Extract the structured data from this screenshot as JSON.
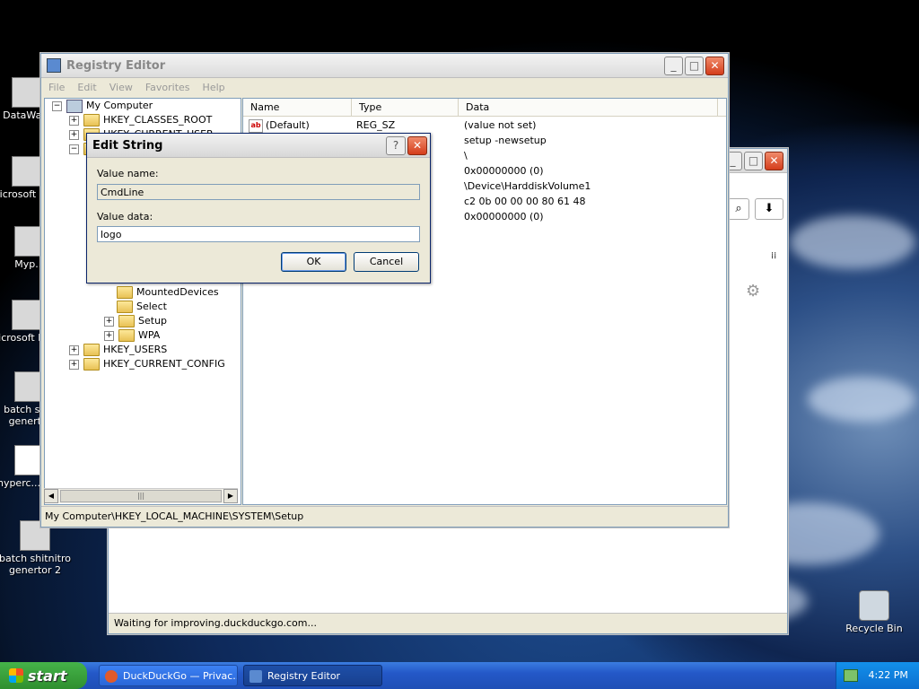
{
  "desktop": {
    "icons": [
      {
        "label": "DataWa..."
      },
      {
        "label": "Microsoft C++"
      },
      {
        "label": "Myp..."
      },
      {
        "label": "Microsoft Basic"
      },
      {
        "label": "batch sh... genert..."
      },
      {
        "label": "hyperc... age"
      },
      {
        "label": "batch shitnitro genertor 2"
      },
      {
        "label": "Recycle Bin"
      }
    ]
  },
  "browser": {
    "status": "Waiting for improving.duckduckgo.com..."
  },
  "regedit": {
    "title": "Registry Editor",
    "menu": [
      "File",
      "Edit",
      "View",
      "Favorites",
      "Help"
    ],
    "tree": [
      {
        "label": "My Computer",
        "level": 0
      },
      {
        "label": "HKEY_CLASSES_ROOT",
        "level": 1
      },
      {
        "label": "HKEY_CURRENT_USER",
        "level": 1
      },
      {
        "label": "MountedDevices",
        "level": 4
      },
      {
        "label": "Select",
        "level": 4
      },
      {
        "label": "Setup",
        "level": 4
      },
      {
        "label": "WPA",
        "level": 4
      },
      {
        "label": "HKEY_USERS",
        "level": 1
      },
      {
        "label": "HKEY_CURRENT_CONFIG",
        "level": 1
      }
    ],
    "columns": {
      "name": "Name",
      "type": "Type",
      "data": "Data"
    },
    "rows": [
      {
        "name": "(Default)",
        "type": "REG_SZ",
        "data": "(value not set)"
      },
      {
        "name": "",
        "type": "",
        "data": "setup -newsetup"
      },
      {
        "name": "",
        "type": "",
        "data": "\\"
      },
      {
        "name": "",
        "type": "",
        "data": "0x00000000 (0)"
      },
      {
        "name": "",
        "type": "",
        "data": "\\Device\\HarddiskVolume1"
      },
      {
        "name": "",
        "type": "",
        "data": "c2 0b 00 00 00 80 61 48"
      },
      {
        "name": "",
        "type": "",
        "data": "0x00000000 (0)"
      }
    ],
    "statusbar": "My Computer\\HKEY_LOCAL_MACHINE\\SYSTEM\\Setup"
  },
  "dialog": {
    "title": "Edit String",
    "value_name_label": "Value name:",
    "value_name": "CmdLine",
    "value_data_label": "Value data:",
    "value_data": "logo",
    "ok": "OK",
    "cancel": "Cancel"
  },
  "taskbar": {
    "start": "start",
    "tasks": [
      {
        "label": "DuckDuckGo — Privac..."
      },
      {
        "label": "Registry Editor"
      }
    ],
    "clock": "4:22 PM"
  }
}
